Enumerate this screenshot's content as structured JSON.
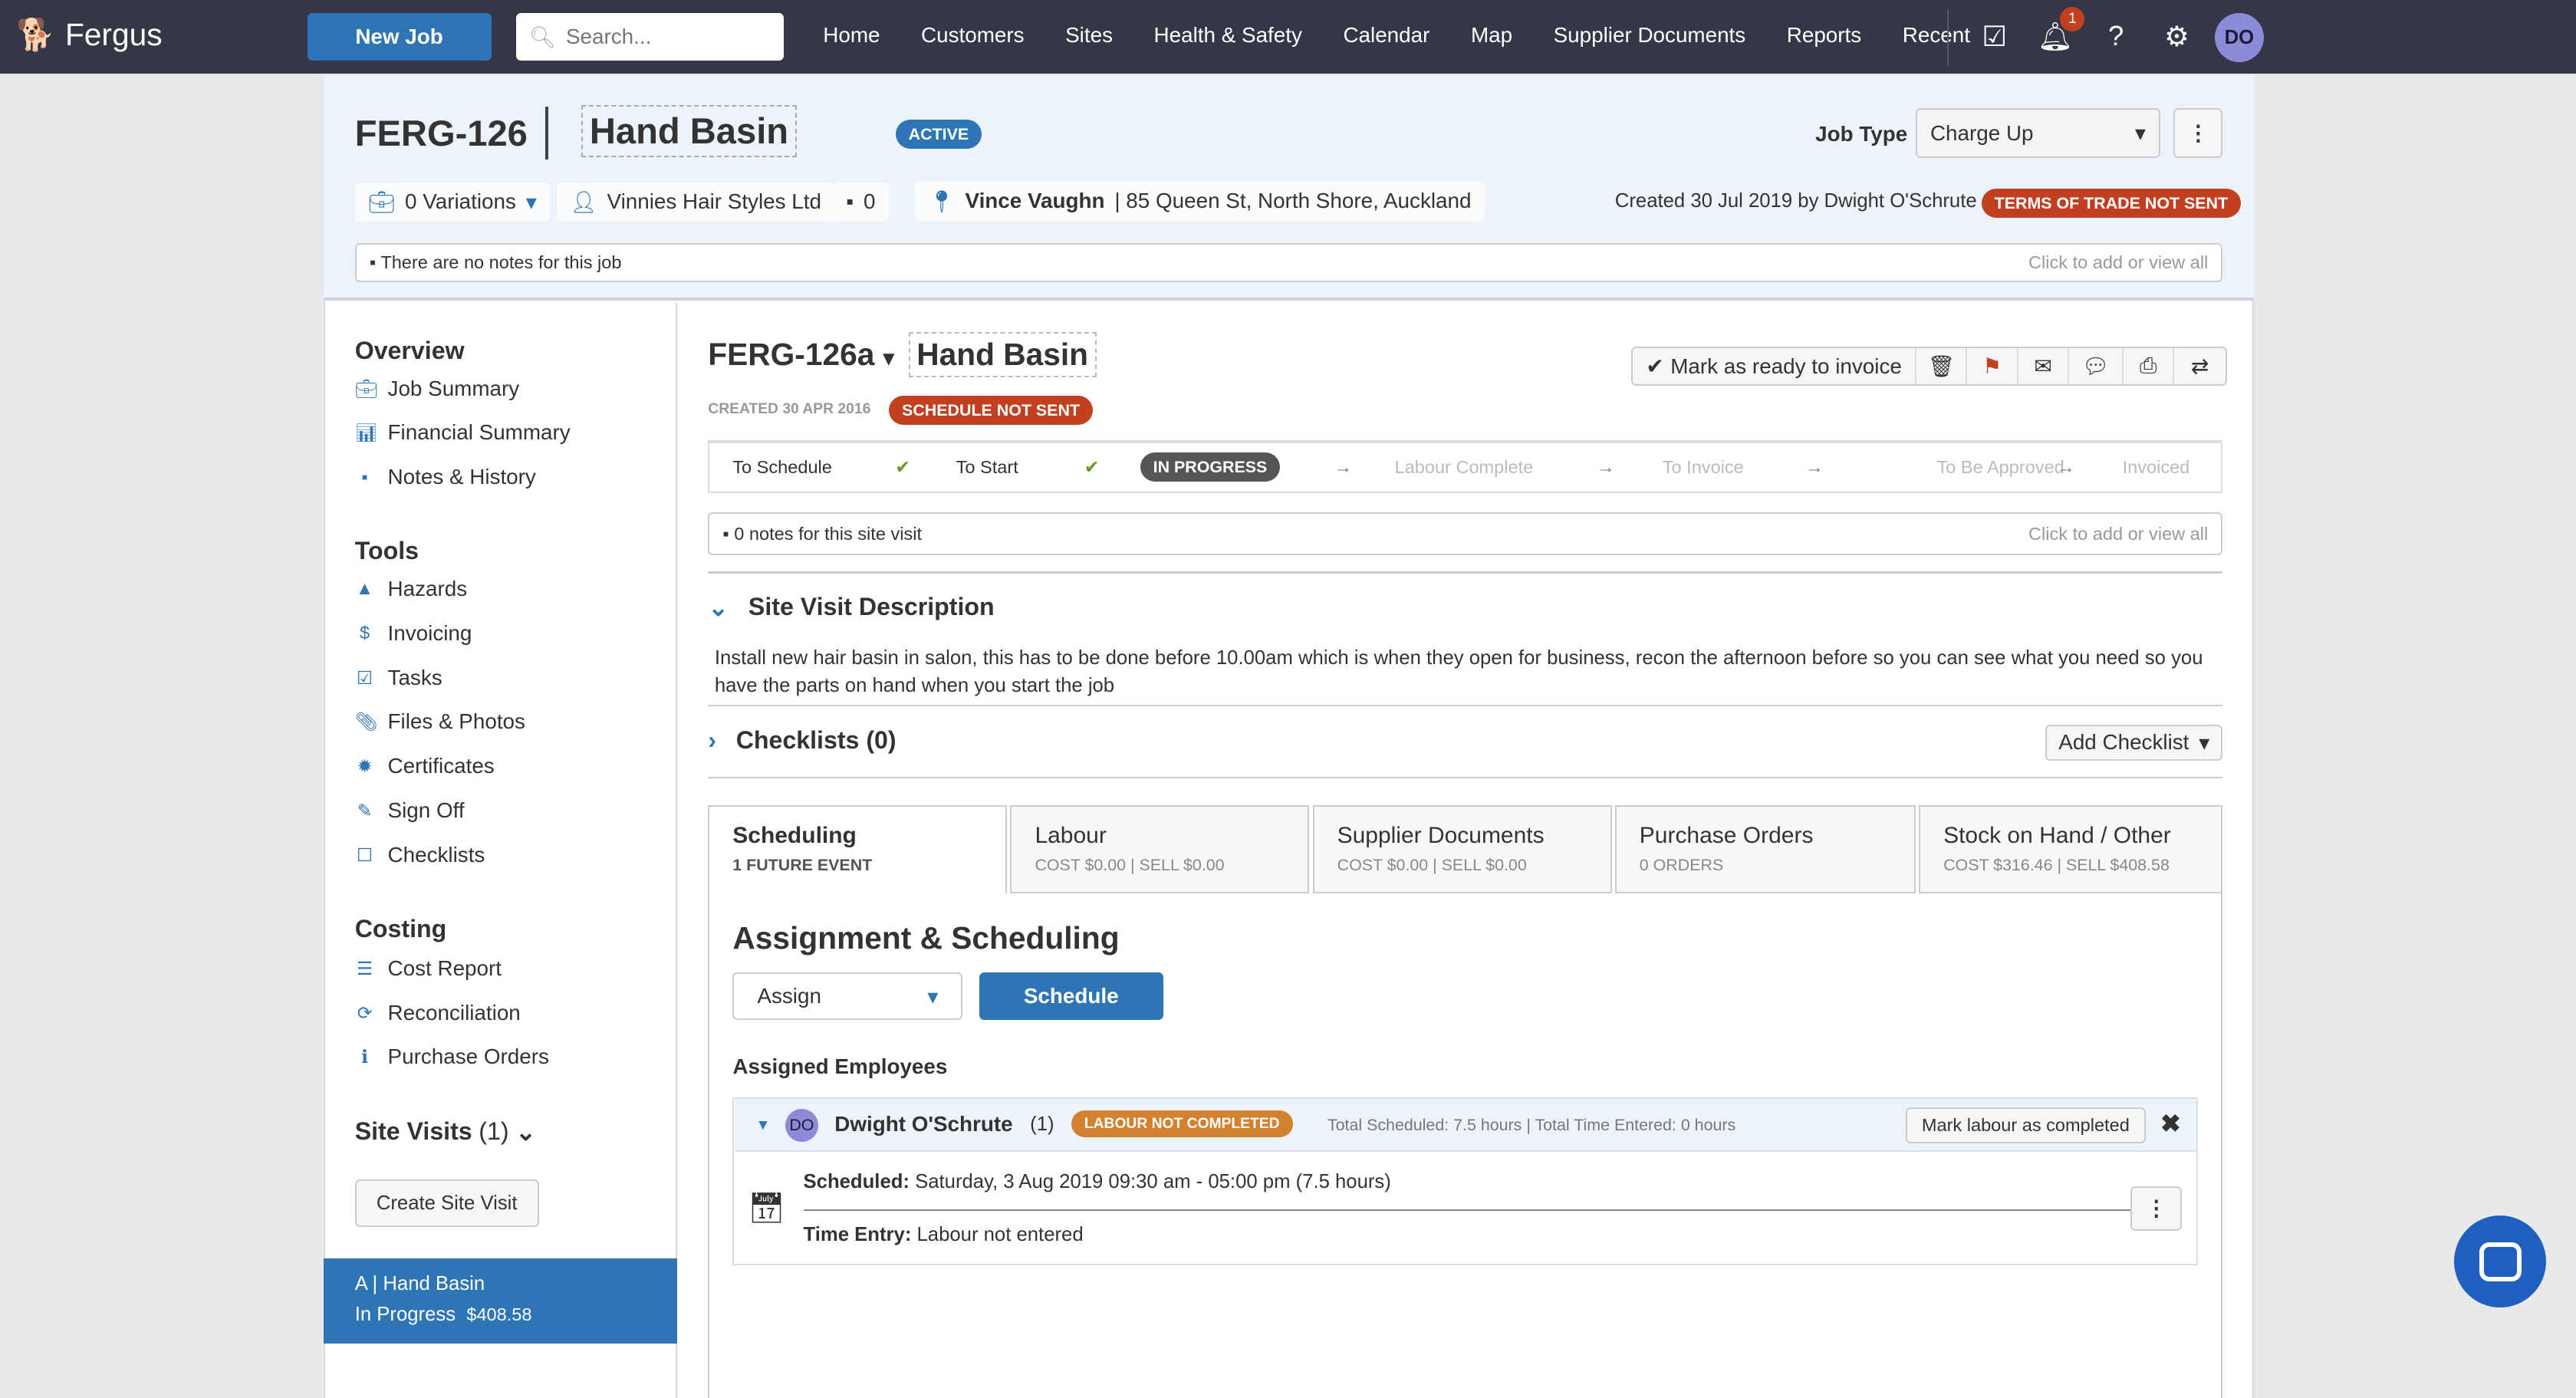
{
  "nav": {
    "logo": "Fergus",
    "new_job": "New Job",
    "search_placeholder": "Search...",
    "links": [
      "Home",
      "Customers",
      "Sites",
      "Health & Safety",
      "Calendar",
      "Map",
      "Supplier Documents",
      "Reports",
      "Recent"
    ],
    "notification_count": "1",
    "avatar": "DO"
  },
  "job": {
    "id": "FERG-126",
    "title": "Hand Basin",
    "status": "ACTIVE",
    "job_type_label": "Job Type",
    "job_type": "Charge Up",
    "variations": "0 Variations",
    "customer": "Vinnies Hair Styles Ltd",
    "customer_notes": "0",
    "site_name": "Vince Vaughn",
    "site_address": "| 85 Queen St, North Shore, Auckland",
    "created": "Created 30 Jul 2019 by Dwight O'Schrute",
    "terms_badge": "TERMS OF TRADE NOT SENT",
    "notes": "There are  no notes for this job",
    "notes_action": "Click to add or view all"
  },
  "sidebar": {
    "overview": "Overview",
    "overview_items": [
      {
        "label": "Job Summary",
        "icon": "briefcase-icon"
      },
      {
        "label": "Financial Summary",
        "icon": "bar-chart-icon"
      },
      {
        "label": "Notes & History",
        "icon": "note-icon"
      }
    ],
    "tools": "Tools",
    "tools_items": [
      {
        "label": "Hazards",
        "icon": "warning-icon"
      },
      {
        "label": "Invoicing",
        "icon": "dollar-icon"
      },
      {
        "label": "Tasks",
        "icon": "checkbox-icon"
      },
      {
        "label": "Files & Photos",
        "icon": "paperclip-icon"
      },
      {
        "label": "Certificates",
        "icon": "certificate-icon"
      },
      {
        "label": "Sign Off",
        "icon": "pencil-icon"
      },
      {
        "label": "Checklists",
        "icon": "square-icon"
      }
    ],
    "costing": "Costing",
    "costing_items": [
      {
        "label": "Cost Report",
        "icon": "list-icon"
      },
      {
        "label": "Reconciliation",
        "icon": "refresh-icon"
      },
      {
        "label": "Purchase Orders",
        "icon": "info-icon"
      }
    ],
    "site_visits": "Site Visits",
    "site_visits_count": "(1)",
    "create_site_visit": "Create Site Visit",
    "active_visit": {
      "letter": "A",
      "title": "Hand Basin",
      "status": "In Progress",
      "amount": "$408.58"
    }
  },
  "visit": {
    "id": "FERG-126a",
    "title": "Hand Basin",
    "created": "CREATED 30 APR 2016",
    "schedule_badge": "SCHEDULE NOT SENT",
    "mark_ready": "Mark as ready to invoice",
    "stages": [
      {
        "label": "To Schedule",
        "state": "done"
      },
      {
        "label": "To Start",
        "state": "done"
      },
      {
        "label": "IN PROGRESS",
        "state": "current"
      },
      {
        "label": "Labour Complete",
        "state": "todo"
      },
      {
        "label": "To Invoice",
        "state": "todo"
      },
      {
        "label": "To Be Approved",
        "state": "todo"
      },
      {
        "label": "Invoiced",
        "state": "todo"
      }
    ],
    "notes": "0 notes for this site visit",
    "notes_action": "Click to add or view all",
    "desc_title": "Site Visit Description",
    "description": "Install new hair basin in salon, this has to be done before 10.00am which is when they open for business, recon the afternoon before so you can see what you need so you have the parts on hand when you start the job",
    "checklists": "Checklists (0)",
    "add_checklist": "Add Checklist",
    "tabs": [
      {
        "title": "Scheduling",
        "sub": "1 FUTURE EVENT"
      },
      {
        "title": "Labour",
        "sub": "COST $0.00 | SELL $0.00"
      },
      {
        "title": "Supplier Documents",
        "sub": "COST $0.00 | SELL $0.00"
      },
      {
        "title": "Purchase Orders",
        "sub": "0 ORDERS"
      },
      {
        "title": "Stock on Hand / Other",
        "sub": "COST $316.46 | SELL $408.58"
      }
    ],
    "assign_title": "Assignment & Scheduling",
    "assign_select": "Assign",
    "schedule_btn": "Schedule",
    "assigned_title": "Assigned Employees",
    "employee": {
      "initials": "DO",
      "name": "Dwight O'Schrute",
      "count": "(1)",
      "badge": "LABOUR NOT COMPLETED",
      "totals": "Total Scheduled: 7.5 hours | Total Time Entered: 0 hours",
      "mark_complete": "Mark labour as completed",
      "scheduled_label": "Scheduled:",
      "scheduled": "Saturday, 3 Aug 2019 09:30 am - 05:00 pm (7.5 hours)",
      "time_label": "Time Entry:",
      "time": "Labour not entered"
    }
  },
  "colors": {
    "nav": "#343846",
    "accent": "#2e75b6",
    "danger": "#c0401f",
    "warning": "#d4812f"
  }
}
